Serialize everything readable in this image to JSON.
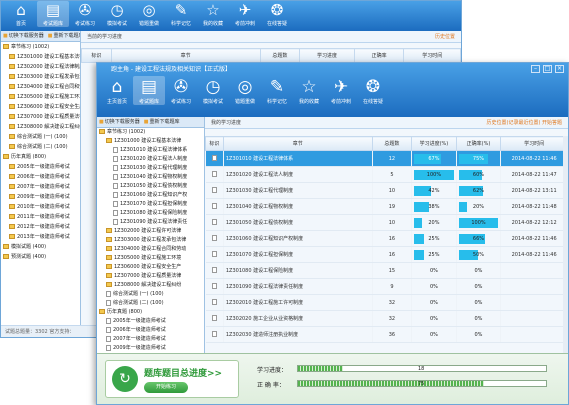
{
  "back_window": {
    "nav": [
      {
        "icon": "home-icon",
        "glyph": "⌂",
        "label": "首页"
      },
      {
        "icon": "exam-icon",
        "glyph": "▤",
        "label": "考试题库"
      },
      {
        "icon": "compass-icon",
        "glyph": "✇",
        "label": "考试练习"
      },
      {
        "icon": "clock-icon",
        "glyph": "◷",
        "label": "模拟考试"
      },
      {
        "icon": "target-icon",
        "glyph": "◎",
        "label": "错题重做"
      },
      {
        "icon": "pen-icon",
        "glyph": "✎",
        "label": "科学记忆"
      },
      {
        "icon": "star-icon",
        "glyph": "☆",
        "label": "我的收藏"
      },
      {
        "icon": "plane-icon",
        "glyph": "✈",
        "label": "考前冲刺"
      },
      {
        "icon": "help-icon",
        "glyph": "❂",
        "label": "在线答疑"
      }
    ],
    "tree_tabs": [
      "切换下载服务器",
      "重新下载题库"
    ],
    "tree": [
      "章节练习 (1002)",
      "1Z301000 建设工程基本法律",
      "1Z302000 建设工程法律制度",
      "1Z303000 建设工程发承包法律",
      "1Z304000 建设工程合同和劳动",
      "1Z305000 建设工程施工环境",
      "1Z306000 建设工程安全生产",
      "1Z307000 建设工程质量法律",
      "1Z308000 解决建设工程纠纷",
      "综合测试题 (一) (100)",
      "综合测试题 (二) (100)",
      "历年真题 (800)",
      "2005年一级建造师考试",
      "2006年一级建造师考试",
      "2007年一级建造师考试",
      "2009年一级建造师考试",
      "2010年一级建造师考试",
      "2011年一级建造师考试",
      "2012年一级建造师考试",
      "2013年一级建造师考试",
      "模拟试题 (400)",
      "预测试题 (400)"
    ],
    "crumb": "当前的学习进度",
    "crumb_right": "历史位置",
    "headers": [
      "标识",
      "章节",
      "总题数",
      "学习进度",
      "正确率",
      "学习时间"
    ],
    "status": "试题总题量：3302    官方支持："
  },
  "front_window": {
    "title": "跑主角 - 建设工程法规及相关知识【正式版】",
    "nav": [
      {
        "icon": "home-icon",
        "glyph": "⌂",
        "label": "主页首页"
      },
      {
        "icon": "exam-icon",
        "glyph": "▤",
        "label": "考试题库"
      },
      {
        "icon": "compass-icon",
        "glyph": "✇",
        "label": "考试练习"
      },
      {
        "icon": "clock-icon",
        "glyph": "◷",
        "label": "模拟考试"
      },
      {
        "icon": "target-icon",
        "glyph": "◎",
        "label": "错题重做"
      },
      {
        "icon": "pen-icon",
        "glyph": "✎",
        "label": "科学记忆"
      },
      {
        "icon": "star-icon",
        "glyph": "☆",
        "label": "我的收藏"
      },
      {
        "icon": "plane-icon",
        "glyph": "✈",
        "label": "考前冲刺"
      },
      {
        "icon": "help-icon",
        "glyph": "❂",
        "label": "在线答疑"
      }
    ],
    "tree_tabs": [
      "切换下载服务器",
      "重新下载题库"
    ],
    "tree": [
      {
        "t": "章节练习 (1002)",
        "d": 0,
        "k": "folder"
      },
      {
        "t": "1Z301000 建设工程基本法律",
        "d": 1,
        "k": "folder"
      },
      {
        "t": "1Z301010 建设工程法律体系",
        "d": 2,
        "k": "doc"
      },
      {
        "t": "1Z301020 建设工程法人制度",
        "d": 2,
        "k": "doc"
      },
      {
        "t": "1Z301030 建设工程代理制度",
        "d": 2,
        "k": "doc"
      },
      {
        "t": "1Z301040 建设工程物权制度",
        "d": 2,
        "k": "doc"
      },
      {
        "t": "1Z301050 建设工程债权制度",
        "d": 2,
        "k": "doc"
      },
      {
        "t": "1Z301060 建设工程知识产权",
        "d": 2,
        "k": "doc"
      },
      {
        "t": "1Z301070 建设工程担保制度",
        "d": 2,
        "k": "doc"
      },
      {
        "t": "1Z301080 建设工程保险制度",
        "d": 2,
        "k": "doc"
      },
      {
        "t": "1Z301090 建设工程法律责任",
        "d": 2,
        "k": "doc"
      },
      {
        "t": "1Z302000 建设工程许可法律",
        "d": 1,
        "k": "folder"
      },
      {
        "t": "1Z303000 建设工程发承包法律",
        "d": 1,
        "k": "folder"
      },
      {
        "t": "1Z304000 建设工程合同和劳动",
        "d": 1,
        "k": "folder"
      },
      {
        "t": "1Z305000 建设工程施工环境",
        "d": 1,
        "k": "folder"
      },
      {
        "t": "1Z306000 建设工程安全生产",
        "d": 1,
        "k": "folder"
      },
      {
        "t": "1Z307000 建设工程质量法律",
        "d": 1,
        "k": "folder"
      },
      {
        "t": "1Z308000 解决建设工程纠纷",
        "d": 1,
        "k": "folder"
      },
      {
        "t": "综合测试题 (一) (100)",
        "d": 1,
        "k": "doc"
      },
      {
        "t": "综合测试题 (二) (100)",
        "d": 1,
        "k": "doc"
      },
      {
        "t": "历年真题 (800)",
        "d": 0,
        "k": "folder"
      },
      {
        "t": "2005年一级建造师考试",
        "d": 1,
        "k": "doc"
      },
      {
        "t": "2006年一级建造师考试",
        "d": 1,
        "k": "doc"
      },
      {
        "t": "2007年一级建造师考试",
        "d": 1,
        "k": "doc"
      },
      {
        "t": "2009年一级建造师考试",
        "d": 1,
        "k": "doc"
      },
      {
        "t": "2010年一级建造师考试",
        "d": 1,
        "k": "doc"
      }
    ],
    "crumb": "我的学习进度",
    "crumb_right": "历史位置(记录最近位置)    开始答题",
    "headers": [
      "标识",
      "章节",
      "总题数",
      "学习进度(%)",
      "正确率(%)",
      "学习时间"
    ],
    "rows": [
      {
        "chapter": "1Z301010 建设工程法律体系",
        "total": "12",
        "progress": 67,
        "accuracy": 75,
        "time": "2014-08-22 11:46",
        "selected": true
      },
      {
        "chapter": "1Z301020 建设工程法人制度",
        "total": "5",
        "progress": 100,
        "accuracy": 60,
        "time": "2014-08-22 11:47",
        "selected": false
      },
      {
        "chapter": "1Z301030 建设工程代理制度",
        "total": "10",
        "progress": 42,
        "accuracy": 62,
        "time": "2014-08-22 13:11",
        "selected": false
      },
      {
        "chapter": "1Z301040 建设工程物权制度",
        "total": "19",
        "progress": 38,
        "accuracy": 20,
        "time": "2014-08-22 11:48",
        "selected": false
      },
      {
        "chapter": "1Z301050 建设工程债权制度",
        "total": "10",
        "progress": 20,
        "accuracy": 100,
        "time": "2014-08-22 12:12",
        "selected": false
      },
      {
        "chapter": "1Z301060 建设工程知识产权制度",
        "total": "16",
        "progress": 25,
        "accuracy": 66,
        "time": "2014-08-22 11:46",
        "selected": false
      },
      {
        "chapter": "1Z301070 建设工程担保制度",
        "total": "16",
        "progress": 25,
        "accuracy": 50,
        "time": "2014-08-22 11:46",
        "selected": false
      },
      {
        "chapter": "1Z301080 建设工程保险制度",
        "total": "15",
        "progress": 0,
        "accuracy": 0,
        "time": "",
        "selected": false
      },
      {
        "chapter": "1Z301090 建设工程法律责任制度",
        "total": "9",
        "progress": 0,
        "accuracy": 0,
        "time": "",
        "selected": false
      },
      {
        "chapter": "1Z302010 建设工程施工许可制度",
        "total": "32",
        "progress": 0,
        "accuracy": 0,
        "time": "",
        "selected": false
      },
      {
        "chapter": "1Z302020 施工企业从业资格制度",
        "total": "32",
        "progress": 0,
        "accuracy": 0,
        "time": "",
        "selected": false
      },
      {
        "chapter": "1Z302030 建造师注册执业制度",
        "total": "36",
        "progress": 0,
        "accuracy": 0,
        "time": "",
        "selected": false
      }
    ],
    "summary": {
      "title": "题库题目总进度>>",
      "button": "开始练习",
      "progress_label": "学习进度：",
      "progress_value": "18",
      "progress": 0.18,
      "accuracy_label": "正 确 率：",
      "accuracy_value": "75",
      "accuracy": 0.75
    }
  }
}
